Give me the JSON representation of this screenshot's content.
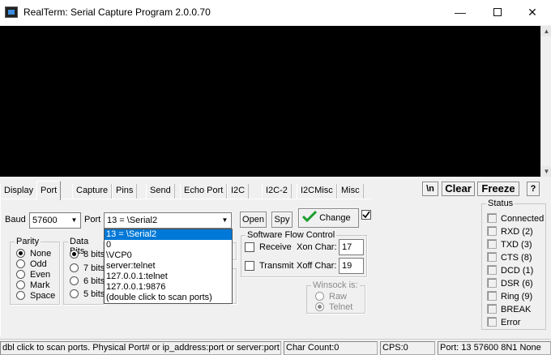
{
  "window": {
    "title": "RealTerm: Serial Capture Program 2.0.0.70",
    "minimize": "—",
    "close": "✕"
  },
  "terminal": {
    "background": "#000000"
  },
  "tabs": [
    "Display",
    "Port",
    "Capture",
    "Pins",
    "Send",
    "Echo Port",
    "I2C",
    "I2C-2",
    "I2CMisc",
    "Misc"
  ],
  "toolbar": {
    "newline": "\\n",
    "clear": "Clear",
    "freeze": "Freeze",
    "help": "?"
  },
  "port": {
    "baud_label": "Baud",
    "baud_value": "57600",
    "port_label": "Port",
    "port_value": "13 = \\Serial2",
    "open_button": "Open",
    "spy_button": "Spy",
    "change_button": "Change",
    "port_options": [
      "13 = \\Serial2",
      "0",
      "\\VCP0",
      "server:telnet",
      "127.0.0.1:telnet",
      "127.0.0.1:9876",
      "(double click to scan ports)"
    ]
  },
  "parity": {
    "title": "Parity",
    "options": [
      "None",
      "Odd",
      "Even",
      "Mark",
      "Space"
    ],
    "selected": "None"
  },
  "data_bits": {
    "title": "Data Bits",
    "options": [
      "8 bits",
      "7 bits",
      "6 bits",
      "5 bits"
    ],
    "selected": "8 bits"
  },
  "flow": {
    "title": "Software Flow Control",
    "receive_label": "Receive",
    "xon_label": "Xon Char:",
    "xon_value": "17",
    "transmit_label": "Transmit",
    "xoff_label": "Xoff Char:",
    "xoff_value": "19"
  },
  "winsock": {
    "title": "Winsock is:",
    "options": [
      "Raw",
      "Telnet"
    ],
    "selected": "Telnet"
  },
  "status": {
    "title": "Status",
    "items": [
      "Connected",
      "RXD (2)",
      "TXD (3)",
      "CTS (8)",
      "DCD (1)",
      "DSR (6)",
      "Ring (9)",
      "BREAK",
      "Error"
    ]
  },
  "statusbar": {
    "hint": "dbl click to scan ports. Physical Port# or ip_address:port or server:port",
    "char_count": "Char Count:0",
    "cps": "CPS:0",
    "port_summary": "Port: 13 57600 8N1 None"
  },
  "colors": {
    "selection": "#0078d7",
    "check_green": "#1e9e2e"
  }
}
